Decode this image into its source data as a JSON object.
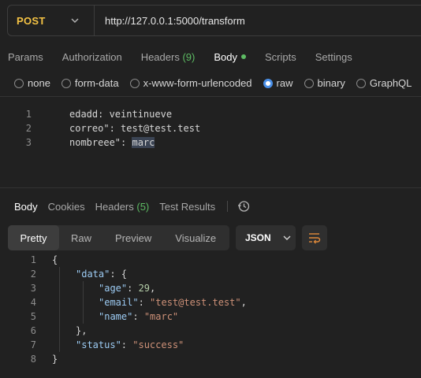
{
  "request": {
    "method": "POST",
    "url": "http://127.0.0.1:5000/transform"
  },
  "request_tabs": {
    "params": "Params",
    "authorization": "Authorization",
    "headers": "Headers",
    "headers_count": "(9)",
    "body": "Body",
    "scripts": "Scripts",
    "settings": "Settings"
  },
  "body_types": {
    "none": "none",
    "form_data": "form-data",
    "urlencoded": "x-www-form-urlencoded",
    "raw": "raw",
    "binary": "binary",
    "graphql": "GraphQL",
    "selected": "raw"
  },
  "request_body": {
    "lines": [
      {
        "n": "1",
        "text": "edadd: veintinueve"
      },
      {
        "n": "2",
        "text": "correo\": test@test.test"
      },
      {
        "n": "3",
        "prefix": "nombreee\": ",
        "highlight": "marc"
      }
    ]
  },
  "response_tabs": {
    "body": "Body",
    "cookies": "Cookies",
    "headers": "Headers",
    "headers_count": "(5)",
    "test_results": "Test Results"
  },
  "view_modes": {
    "pretty": "Pretty",
    "raw": "Raw",
    "preview": "Preview",
    "visualize": "Visualize"
  },
  "format_select": "JSON",
  "response_body": {
    "line_numbers": [
      "1",
      "2",
      "3",
      "4",
      "5",
      "6",
      "7",
      "8"
    ],
    "l1": "{",
    "data_key": "\"data\"",
    "l2_rest": ": {",
    "age_key": "\"age\"",
    "age_val": "29",
    "email_key": "\"email\"",
    "email_val": "\"test@test.test\"",
    "name_key": "\"name\"",
    "name_val": "\"marc\"",
    "l6": "},",
    "status_key": "\"status\"",
    "status_val": "\"success\"",
    "l8": "}",
    "colon_sp": ": ",
    "comma": ","
  },
  "colors": {
    "method": "#f5c344",
    "accent_green": "#5dbb63",
    "radio_selected": "#4a8fe7",
    "json_key": "#9ccbf3",
    "json_string": "#ce9178",
    "json_number": "#b5cea8"
  },
  "icons": {
    "method_dropdown": "chevron-down-icon",
    "history": "history-icon",
    "format_dropdown": "chevron-down-icon",
    "wrap": "wrap-lines-icon"
  }
}
